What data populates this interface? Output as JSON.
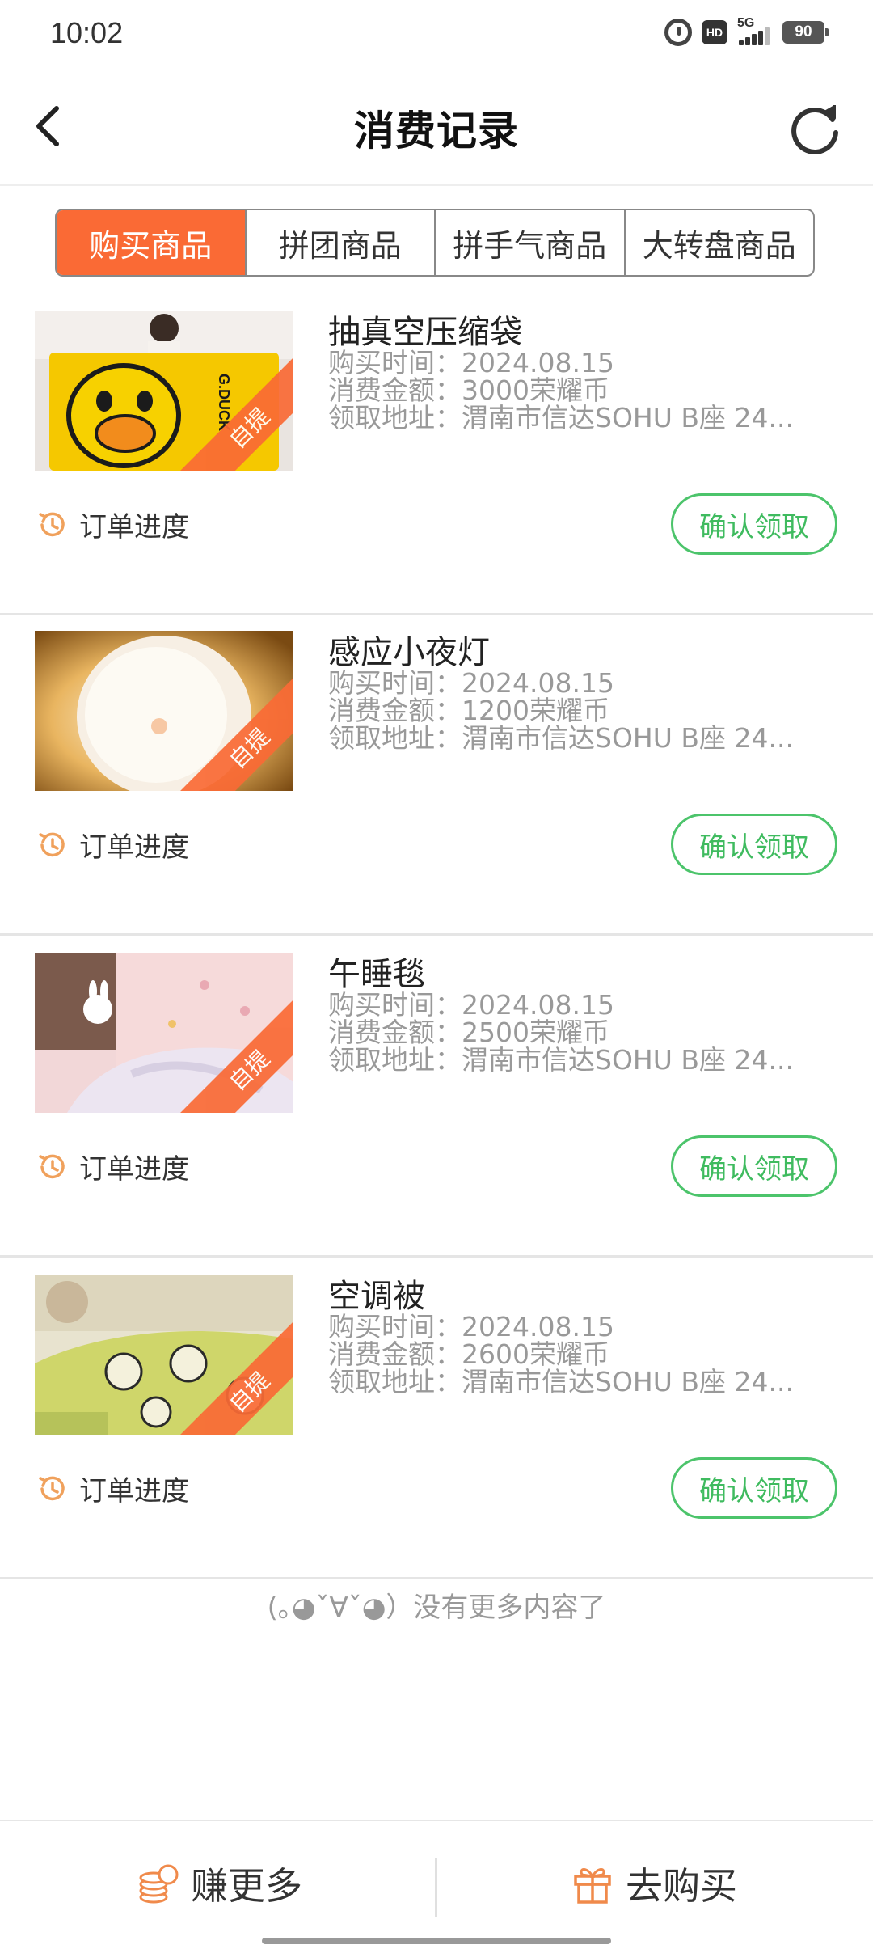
{
  "status_bar": {
    "time": "10:02",
    "hd_label": "HD",
    "network_label": "5G",
    "battery": "90"
  },
  "header": {
    "title": "消费记录"
  },
  "tabs": [
    {
      "label": "购买商品",
      "active": true
    },
    {
      "label": "拼团商品",
      "active": false
    },
    {
      "label": "拼手气商品",
      "active": false
    },
    {
      "label": "大转盘商品",
      "active": false
    }
  ],
  "orders": [
    {
      "name": "抽真空压缩袋",
      "purchase_time": "购买时间：2024.08.15",
      "amount": "消费金额：3000荣耀币",
      "address": "领取地址：渭南市信达SOHU B座 24...",
      "tag": "自提",
      "progress_label": "订单进度",
      "confirm_label": "确认领取"
    },
    {
      "name": "感应小夜灯",
      "purchase_time": "购买时间：2024.08.15",
      "amount": "消费金额：1200荣耀币",
      "address": "领取地址：渭南市信达SOHU B座 24...",
      "tag": "自提",
      "progress_label": "订单进度",
      "confirm_label": "确认领取"
    },
    {
      "name": "午睡毯",
      "purchase_time": "购买时间：2024.08.15",
      "amount": "消费金额：2500荣耀币",
      "address": "领取地址：渭南市信达SOHU B座 24...",
      "tag": "自提",
      "progress_label": "订单进度",
      "confirm_label": "确认领取"
    },
    {
      "name": "空调被",
      "purchase_time": "购买时间：2024.08.15",
      "amount": "消费金额：2600荣耀币",
      "address": "领取地址：渭南市信达SOHU B座 24...",
      "tag": "自提",
      "progress_label": "订单进度",
      "confirm_label": "确认领取"
    }
  ],
  "footer_note": "(｡◕ˇ∀ˇ◕）没有更多内容了",
  "bottom_bar": {
    "earn_label": "赚更多",
    "buy_label": "去购买"
  },
  "colors": {
    "accent": "#fa6a35",
    "confirm": "#3fbb5f",
    "muted_text": "#999999"
  }
}
